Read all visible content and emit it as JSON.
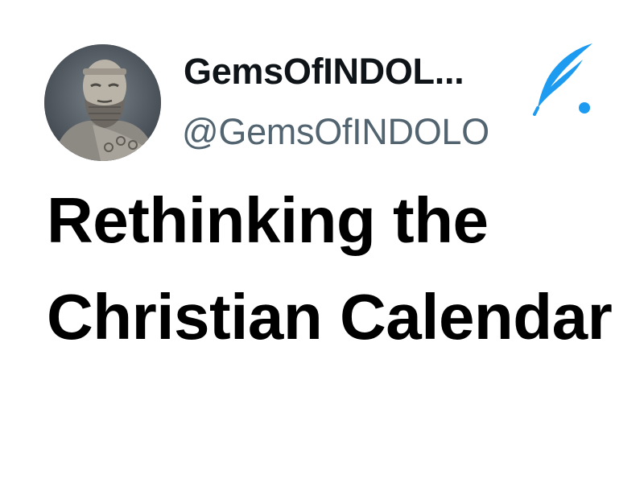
{
  "profile": {
    "display_name": "GemsOfINDOL...",
    "handle": "@GemsOfINDOLO",
    "avatar_icon": "bearded-statue-avatar",
    "badge_icon": "quill-icon"
  },
  "headline": {
    "text": "Rethinking the Christian Calendar"
  },
  "colors": {
    "name": "#0f1419",
    "handle": "#536471",
    "accent": "#1d9bf0",
    "headline": "#000000",
    "background": "#ffffff"
  }
}
